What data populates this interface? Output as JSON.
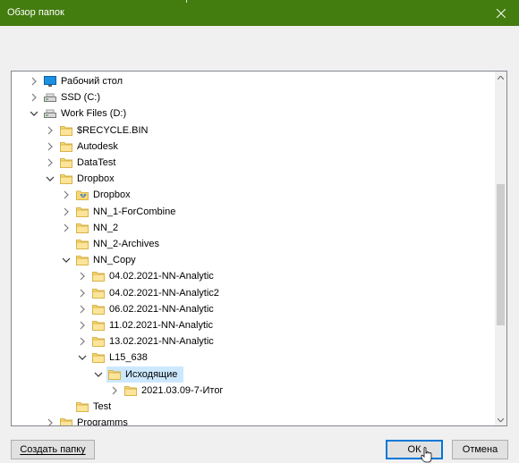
{
  "window": {
    "title": "Обзор папок"
  },
  "tree": {
    "items": [
      {
        "label": "Рабочий стол",
        "depth": 0,
        "expander": "collapsed",
        "icon": "desktop-icon"
      },
      {
        "label": "SSD (C:)",
        "depth": 0,
        "expander": "collapsed",
        "icon": "drive-icon"
      },
      {
        "label": "Work Files (D:)",
        "depth": 0,
        "expander": "expanded",
        "icon": "drive-icon"
      },
      {
        "label": "$RECYCLE.BIN",
        "depth": 1,
        "expander": "collapsed",
        "icon": "folder-icon"
      },
      {
        "label": "Autodesk",
        "depth": 1,
        "expander": "collapsed",
        "icon": "folder-icon"
      },
      {
        "label": "DataTest",
        "depth": 1,
        "expander": "collapsed",
        "icon": "folder-icon"
      },
      {
        "label": "Dropbox",
        "depth": 1,
        "expander": "expanded",
        "icon": "folder-icon"
      },
      {
        "label": "Dropbox",
        "depth": 2,
        "expander": "collapsed",
        "icon": "dropbox-folder-icon"
      },
      {
        "label": "NN_1-ForCombine",
        "depth": 2,
        "expander": "collapsed",
        "icon": "folder-icon"
      },
      {
        "label": "NN_2",
        "depth": 2,
        "expander": "collapsed",
        "icon": "folder-icon"
      },
      {
        "label": "NN_2-Archives",
        "depth": 2,
        "expander": "none",
        "icon": "folder-icon"
      },
      {
        "label": "NN_Copy",
        "depth": 2,
        "expander": "expanded",
        "icon": "folder-icon"
      },
      {
        "label": "04.02.2021-NN-Analytic",
        "depth": 3,
        "expander": "collapsed",
        "icon": "folder-icon"
      },
      {
        "label": "04.02.2021-NN-Analytic2",
        "depth": 3,
        "expander": "collapsed",
        "icon": "folder-icon"
      },
      {
        "label": "06.02.2021-NN-Analytic",
        "depth": 3,
        "expander": "collapsed",
        "icon": "folder-icon"
      },
      {
        "label": "11.02.2021-NN-Analytic",
        "depth": 3,
        "expander": "collapsed",
        "icon": "folder-icon"
      },
      {
        "label": "13.02.2021-NN-Analytic",
        "depth": 3,
        "expander": "collapsed",
        "icon": "folder-icon"
      },
      {
        "label": "L15_638",
        "depth": 3,
        "expander": "expanded",
        "icon": "folder-icon"
      },
      {
        "label": "Исходящие",
        "depth": 4,
        "expander": "expanded",
        "icon": "folder-icon",
        "selected": true
      },
      {
        "label": "2021.03.09-7-Итог",
        "depth": 5,
        "expander": "collapsed",
        "icon": "folder-icon"
      },
      {
        "label": "Test",
        "depth": 2,
        "expander": "none",
        "icon": "folder-icon"
      },
      {
        "label": "Programms",
        "depth": 1,
        "expander": "collapsed",
        "icon": "folder-icon"
      }
    ]
  },
  "buttons": {
    "new_folder": "Создать папку",
    "ok": "ОК",
    "cancel": "Отмена"
  },
  "colors": {
    "titlebar": "#437c0f",
    "selection": "#cce8ff",
    "folder": "#f8d775",
    "focus_border": "#0078d7"
  }
}
